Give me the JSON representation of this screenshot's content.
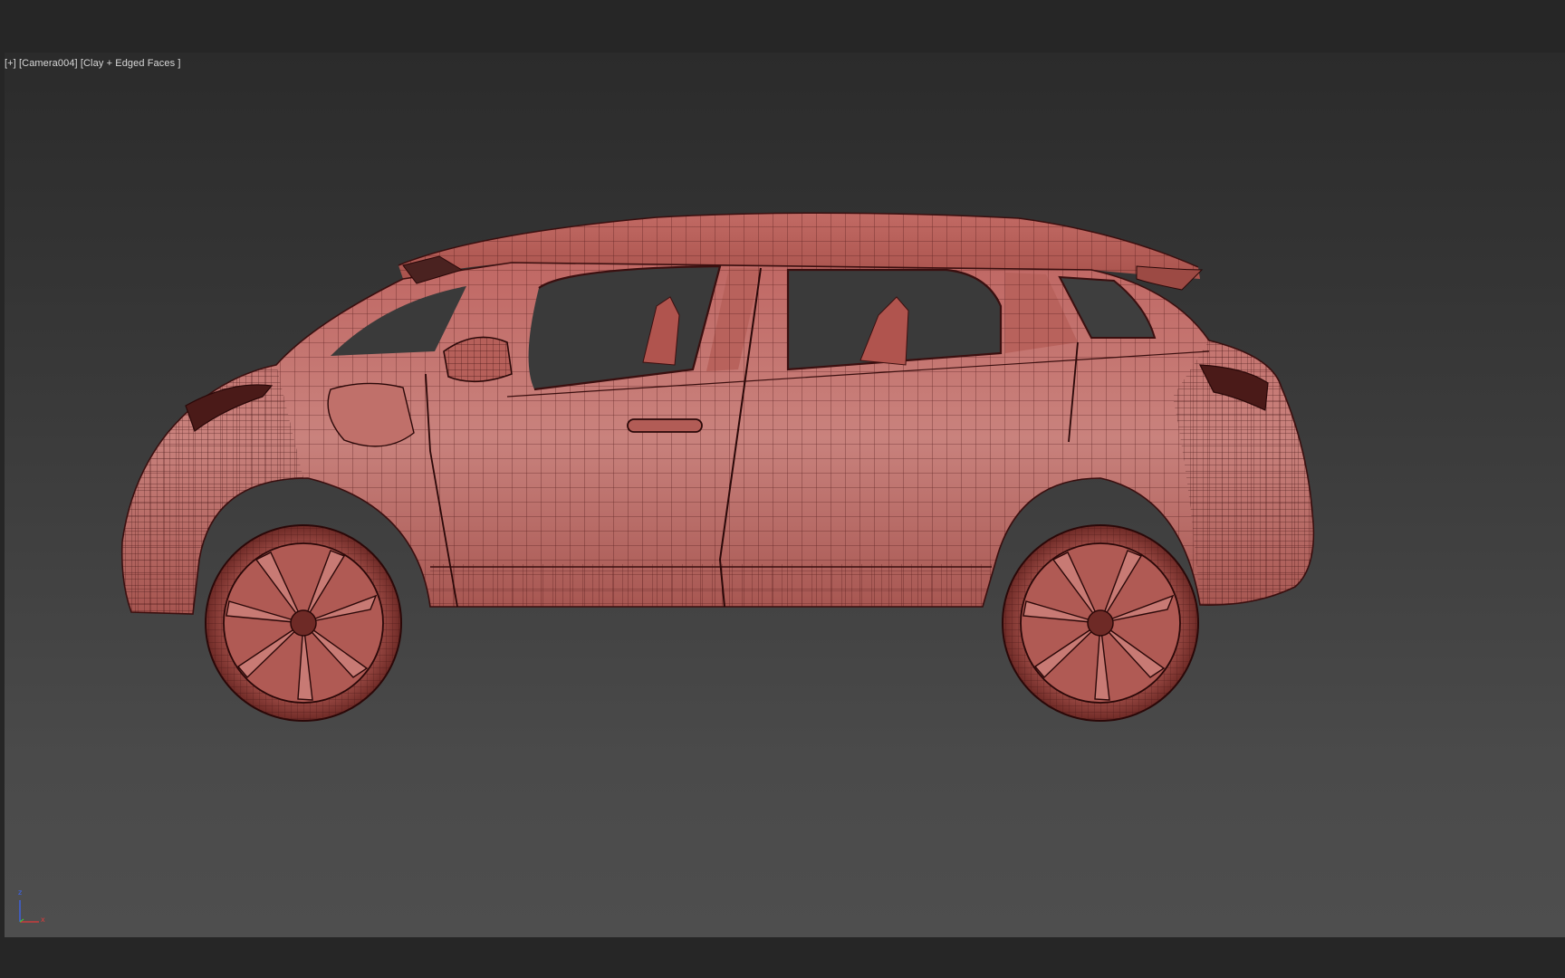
{
  "viewport": {
    "label_plus": "[+]",
    "label_camera": "[Camera004]",
    "label_shading": "[Clay + Edged Faces ]"
  },
  "axis": {
    "z_label": "z",
    "x_label": "x",
    "z_color": "#3a66ff",
    "x_color": "#e03a3a",
    "y_color": "#3cc33c"
  },
  "scene": {
    "object": "car-wireframe",
    "clay_color": "#c86a66",
    "edge_color": "#3a0f0f"
  }
}
